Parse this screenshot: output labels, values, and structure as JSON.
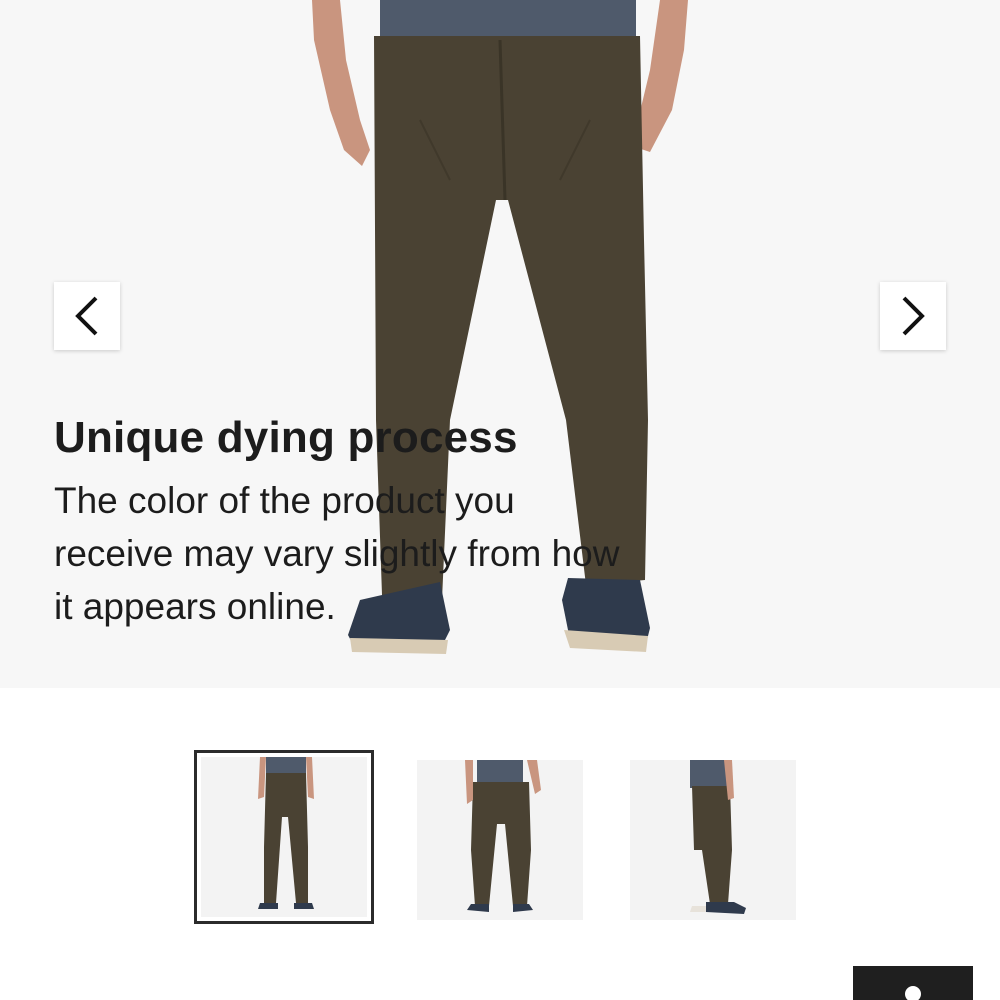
{
  "gallery": {
    "caption": {
      "title": "Unique dying process",
      "body": "The color of the product you receive may vary slightly from how it appears online."
    },
    "prev_icon": "chevron-left-icon",
    "next_icon": "chevron-right-icon",
    "thumbnails": [
      {
        "view": "front",
        "active": true
      },
      {
        "view": "back",
        "active": false
      },
      {
        "view": "side",
        "active": false
      }
    ]
  },
  "colors": {
    "pants": "#4a4233",
    "shirt": "#4f5a6b",
    "shoes": "#2f3a4c",
    "skin": "#c9957f",
    "accent_dark": "#1f1f1f"
  }
}
